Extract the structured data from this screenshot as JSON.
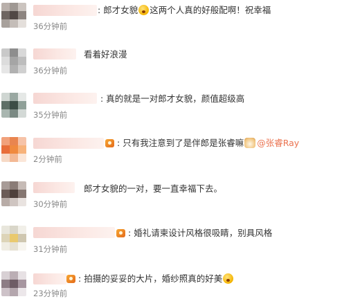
{
  "comments": [
    {
      "parts": [
        ":",
        "郎才女貌",
        "这两个人真的好般配啊！祝幸福"
      ],
      "time": "36分钟前"
    },
    {
      "parts": [
        "看着好浪漫"
      ],
      "time": "36分钟前"
    },
    {
      "parts": [
        ":",
        "真的就是一对郎才女貌，颜值超级高"
      ],
      "time": "35分钟前"
    },
    {
      "parts": [
        ":",
        "只有我注意到了是伴郎是张睿嘛",
        "@张睿Ray"
      ],
      "time": "2分钟前"
    },
    {
      "parts": [
        "郎才女貌的一对，要一直幸福下去。"
      ],
      "time": "30分钟前"
    },
    {
      "parts": [
        ":",
        "婚礼请柬设计风格很吸睛，别具风格"
      ],
      "time": "31分钟前"
    },
    {
      "parts": [
        ":",
        "拍摄的妥妥的大片，婚纱照真的好美"
      ],
      "time": "23分钟前"
    }
  ],
  "icons": {
    "emoji": "shocked-face-emoji-icon",
    "badge": "member-badge-icon",
    "cat": "cat-emoji-icon"
  },
  "colors": {
    "mention": "#eb7350",
    "time": "#888888",
    "text": "#333333"
  }
}
